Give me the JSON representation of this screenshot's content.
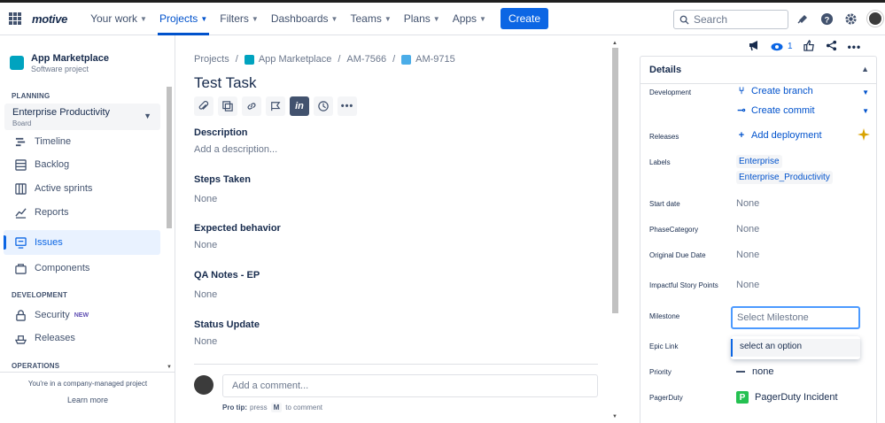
{
  "topnav": {
    "logo": "motive",
    "items": [
      {
        "label": "Your work",
        "active": false
      },
      {
        "label": "Projects",
        "active": true
      },
      {
        "label": "Filters",
        "active": false
      },
      {
        "label": "Dashboards",
        "active": false
      },
      {
        "label": "Teams",
        "active": false
      },
      {
        "label": "Plans",
        "active": false
      },
      {
        "label": "Apps",
        "active": false
      }
    ],
    "create_label": "Create",
    "search_placeholder": "Search",
    "icons": [
      "notifications-icon",
      "help-icon",
      "settings-icon",
      "profile-avatar"
    ]
  },
  "sidebar": {
    "project_name": "App Marketplace",
    "project_type": "Software project",
    "planning_title": "PLANNING",
    "board_name": "Enterprise Productivity",
    "board_sub": "Board",
    "planning_items": [
      "Timeline",
      "Backlog",
      "Active sprints",
      "Reports"
    ],
    "issues_label": "Issues",
    "components_label": "Components",
    "development_title": "DEVELOPMENT",
    "security_label": "Security",
    "new_badge": "NEW",
    "releases_label": "Releases",
    "operations_title": "OPERATIONS",
    "footer_text": "You're in a company-managed project",
    "learn_more": "Learn more"
  },
  "main": {
    "breadcrumb": [
      "Projects",
      "App Marketplace",
      "AM-7566",
      "AM-9715"
    ],
    "title": "Test Task",
    "fields": [
      {
        "label": "Description",
        "value": "Add a description..."
      },
      {
        "label": "Steps Taken",
        "value": "None"
      },
      {
        "label": "Expected behavior",
        "value": "None"
      },
      {
        "label": "QA Notes - EP",
        "value": "None"
      },
      {
        "label": "Status Update",
        "value": "None"
      }
    ],
    "comment_placeholder": "Add a comment...",
    "protip_label": "Pro tip:",
    "protip_press": "press",
    "protip_key": "M",
    "protip_rest": "to comment"
  },
  "right": {
    "watch_count": "1",
    "details_title": "Details",
    "development_label": "Development",
    "create_branch": "Create branch",
    "create_commit": "Create commit",
    "releases_label": "Releases",
    "add_deployment": "Add deployment",
    "labels_label": "Labels",
    "labels": [
      "Enterprise",
      "Enterprise_Productivity"
    ],
    "start_date_label": "Start date",
    "start_date_value": "None",
    "phase_label": "PhaseCategory",
    "phase_value": "None",
    "due_label": "Original Due Date",
    "due_value": "None",
    "impact_label": "Impactful Story Points",
    "impact_value": "None",
    "milestone_label": "Milestone",
    "milestone_placeholder": "Select Milestone",
    "epic_label": "Epic Link",
    "dropdown_option": "select an option",
    "priority_label": "Priority",
    "priority_value": "none",
    "pagerduty_label": "PagerDuty",
    "pagerduty_value": "PagerDuty Incident",
    "pagerduty_icon_letter": "P"
  }
}
